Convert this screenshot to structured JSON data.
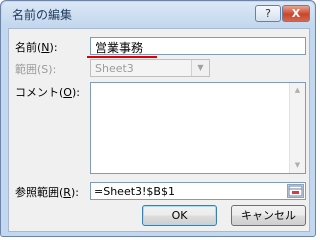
{
  "dialog": {
    "title": "名前の編集",
    "help_label": "?",
    "close_label": "X"
  },
  "fields": {
    "name_label_pre": "名前(",
    "name_label_key": "N",
    "name_label_post": "):",
    "name_value": "営業事務",
    "scope_label": "範囲(S):",
    "scope_value": "Sheet3",
    "comment_label_pre": "コメント(",
    "comment_label_key": "O",
    "comment_label_post": "):",
    "comment_value": "",
    "ref_label_pre": "参照範囲(",
    "ref_label_key": "R",
    "ref_label_post": "):",
    "ref_value": "=Sheet3!$B$1"
  },
  "buttons": {
    "ok": "OK",
    "cancel": "キャンセル"
  },
  "colors": {
    "annotation_underline": "#e00000",
    "close_button": "#c9462c"
  }
}
